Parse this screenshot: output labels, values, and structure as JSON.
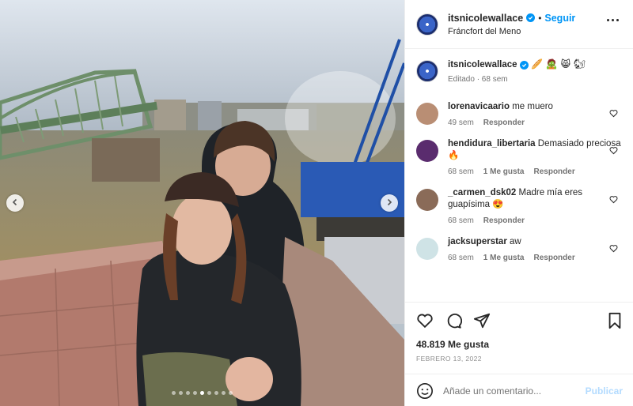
{
  "post": {
    "username": "itsnicolewallace",
    "follow_label": "Seguir",
    "separator": "•",
    "location": "Fráncfort del Meno",
    "caption_emojis": "🥖 🧟 😸 🐿",
    "caption_meta": "Editado · 68 sem"
  },
  "comments": [
    {
      "username": "lorenavicaario",
      "text": "me muero",
      "age": "49 sem",
      "likes": "",
      "reply": "Responder"
    },
    {
      "username": "hendidura_libertaria",
      "text": "Demasiado preciosa 🔥",
      "age": "68 sem",
      "likes": "1 Me gusta",
      "reply": "Responder"
    },
    {
      "username": "_carmen_dsk02",
      "text": "Madre mía eres guapísima 😍",
      "age": "68 sem",
      "likes": "",
      "reply": "Responder"
    },
    {
      "username": "jacksuperstar",
      "text": "aw",
      "age": "68 sem",
      "likes": "1 Me gusta",
      "reply": "Responder"
    }
  ],
  "stats": {
    "likes": "48.819 Me gusta",
    "date": "FEBRERO 13, 2022"
  },
  "composer": {
    "placeholder": "Añade un comentario...",
    "publish_label": "Publicar"
  },
  "carousel": {
    "slides": 9,
    "active_index": 4
  },
  "colors": {
    "accent": "#0095f6",
    "publish_disabled": "#b3dbff",
    "muted": "#737373"
  },
  "icons": [
    "chevron-left-icon",
    "chevron-right-icon",
    "more-options-icon",
    "heart-icon",
    "comment-icon",
    "share-icon",
    "bookmark-icon",
    "emoji-icon",
    "verified-icon"
  ]
}
